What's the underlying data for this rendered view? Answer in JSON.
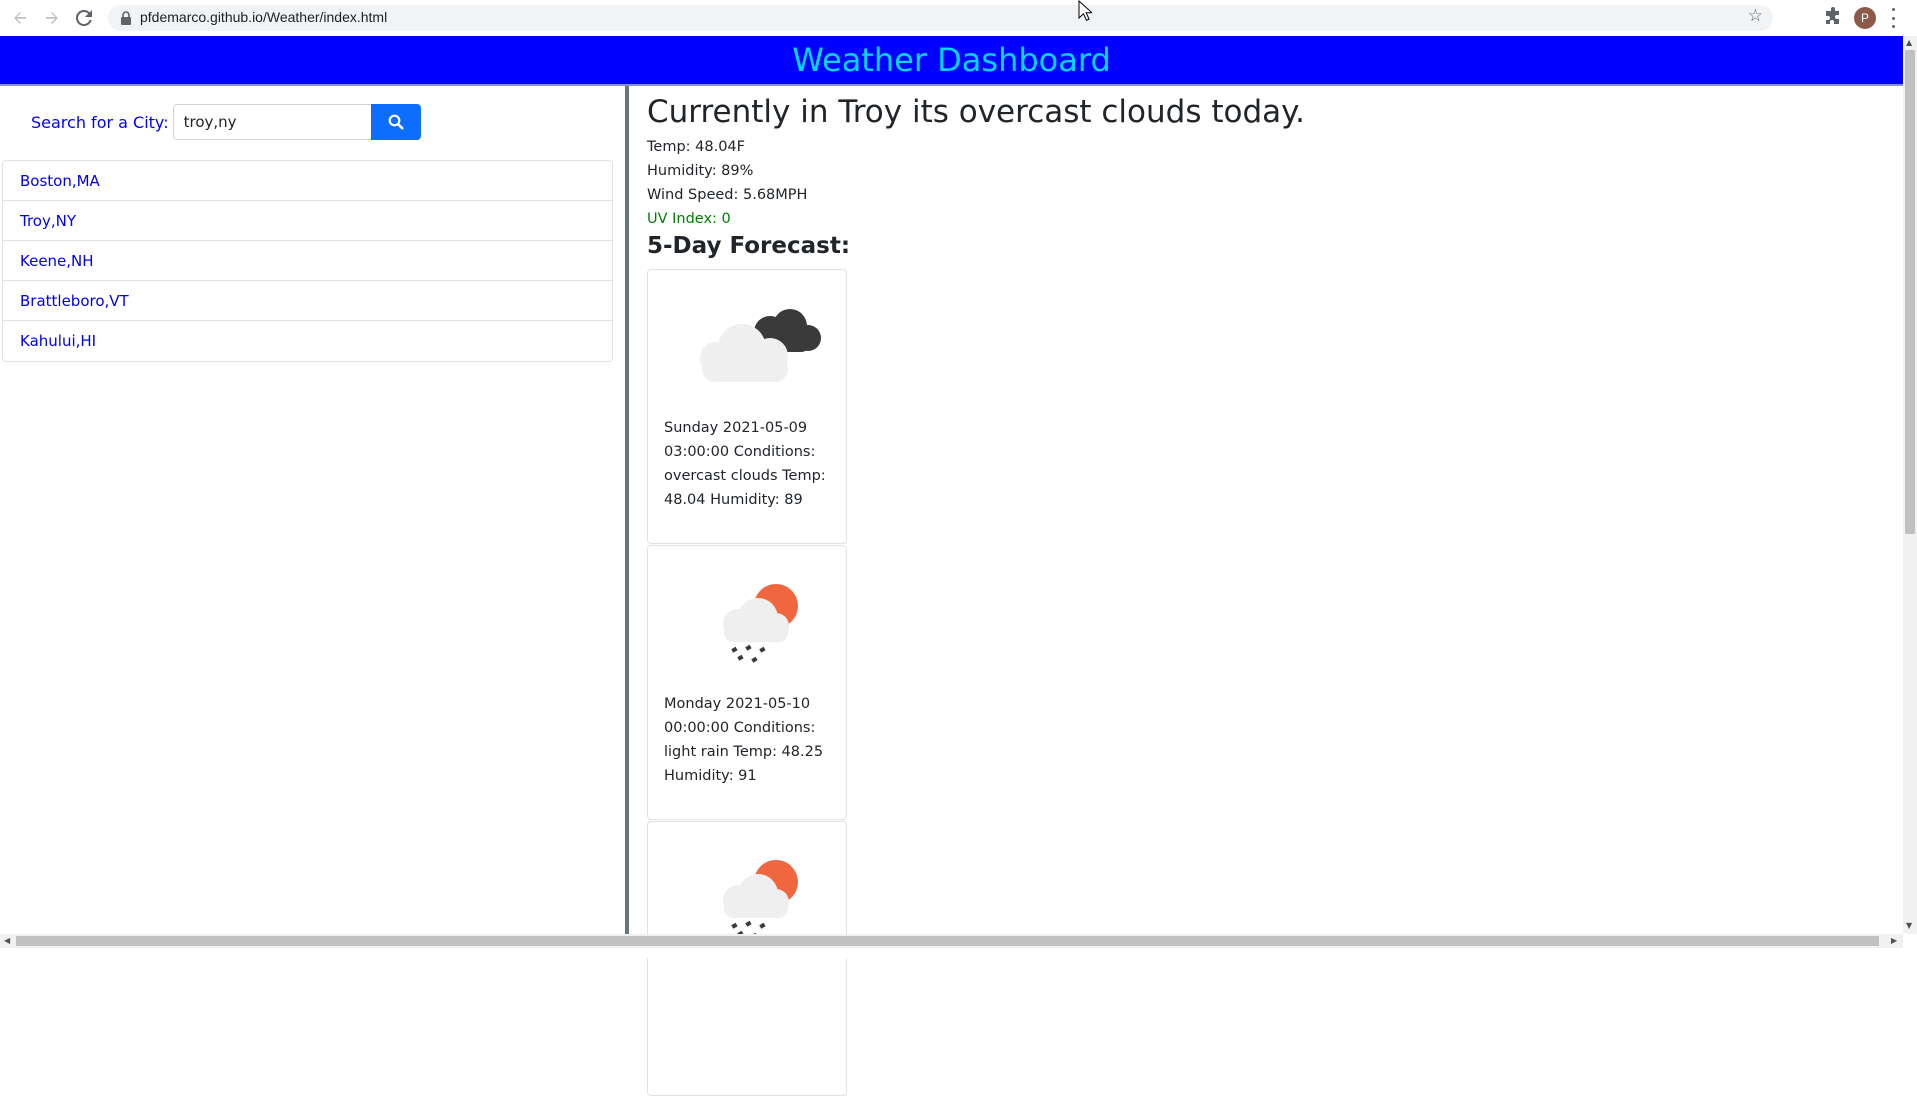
{
  "browser": {
    "url": "pfdemarco.github.io/Weather/index.html",
    "back_icon": "back-arrow-icon",
    "forward_icon": "forward-arrow-icon",
    "reload_icon": "reload-icon",
    "avatar_initial": "P"
  },
  "header": {
    "title": "Weather Dashboard",
    "background": "#0000ff",
    "title_color": "#00d8ff"
  },
  "search": {
    "label": "Search for a City:",
    "value": "troy,ny",
    "button_icon": "search-icon",
    "button_color": "#0d6efd"
  },
  "cities": [
    {
      "label": "Boston,MA"
    },
    {
      "label": "Troy,NY"
    },
    {
      "label": "Keene,NH"
    },
    {
      "label": "Brattleboro,VT"
    },
    {
      "label": "Kahului,HI"
    }
  ],
  "current": {
    "heading": "Currently in Troy its overcast clouds today.",
    "temp": "Temp: 48.04F",
    "humidity": "Humidity: 89%",
    "wind": "Wind Speed: 5.68MPH",
    "uv": "UV Index: 0",
    "uv_color": "#008000"
  },
  "forecast": {
    "heading": "5-Day Forecast:",
    "cards": [
      {
        "icon": "overcast-clouds-icon",
        "text": "Sunday 2021-05-09 03:00:00 Conditions: overcast clouds Temp: 48.04 Humidity: 89"
      },
      {
        "icon": "light-rain-icon",
        "text": "Monday 2021-05-10 00:00:00 Conditions: light rain Temp: 48.25 Humidity: 91"
      },
      {
        "icon": "light-rain-icon",
        "text": ""
      }
    ]
  }
}
